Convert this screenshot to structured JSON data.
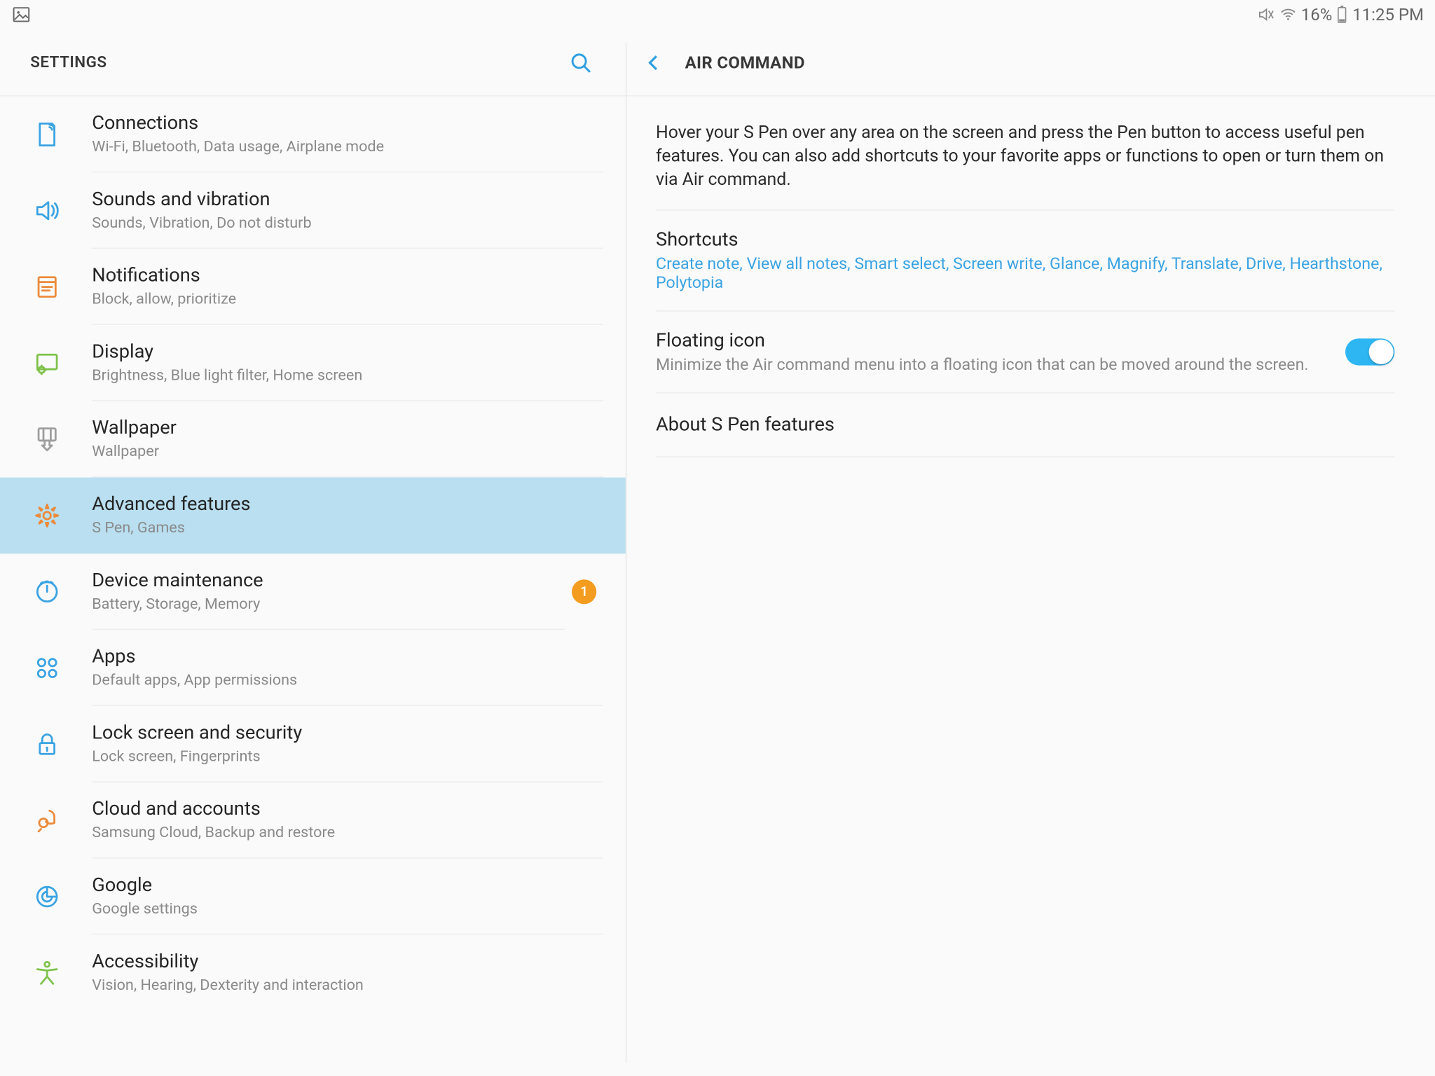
{
  "status": {
    "battery_pct": "16%",
    "time": "11:25 PM"
  },
  "left": {
    "title": "SETTINGS"
  },
  "right": {
    "title": "AIR COMMAND",
    "description": "Hover your S Pen over any area on the screen and press the Pen button to access useful pen features. You can also add shortcuts to your favorite apps or functions to open or turn them on via Air command.",
    "shortcuts": {
      "title": "Shortcuts",
      "list": "Create note, View all notes, Smart select, Screen write, Glance, Magnify, Translate, Drive, Hearthstone, Polytopia"
    },
    "floating": {
      "title": "Floating icon",
      "sub": "Minimize the Air command menu into a floating icon that can be moved around the screen.",
      "on": true
    },
    "about": {
      "title": "About S Pen features"
    }
  },
  "categories": [
    {
      "title": "Connections",
      "sub": "Wi-Fi, Bluetooth, Data usage, Airplane mode",
      "icon": "connections",
      "color": "#3aa3e3"
    },
    {
      "title": "Sounds and vibration",
      "sub": "Sounds, Vibration, Do not disturb",
      "icon": "sound",
      "color": "#3aa3e3"
    },
    {
      "title": "Notifications",
      "sub": "Block, allow, prioritize",
      "icon": "notifications",
      "color": "#ec8a3b"
    },
    {
      "title": "Display",
      "sub": "Brightness, Blue light filter, Home screen",
      "icon": "display",
      "color": "#7fc24b"
    },
    {
      "title": "Wallpaper",
      "sub": "Wallpaper",
      "icon": "wallpaper",
      "color": "#9e9e9e"
    },
    {
      "title": "Advanced features",
      "sub": "S Pen, Games",
      "icon": "advanced",
      "color": "#ec8a3b",
      "selected": true
    },
    {
      "title": "Device maintenance",
      "sub": "Battery, Storage, Memory",
      "icon": "maintenance",
      "color": "#3aa3e3",
      "badge": "1"
    },
    {
      "title": "Apps",
      "sub": "Default apps, App permissions",
      "icon": "apps",
      "color": "#3aa3e3"
    },
    {
      "title": "Lock screen and security",
      "sub": "Lock screen, Fingerprints",
      "icon": "lock",
      "color": "#3aa3e3"
    },
    {
      "title": "Cloud and accounts",
      "sub": "Samsung Cloud, Backup and restore",
      "icon": "cloud",
      "color": "#ec8a3b"
    },
    {
      "title": "Google",
      "sub": "Google settings",
      "icon": "google",
      "color": "#3aa3e3"
    },
    {
      "title": "Accessibility",
      "sub": "Vision, Hearing, Dexterity and interaction",
      "icon": "accessibility",
      "color": "#7fc24b"
    }
  ]
}
